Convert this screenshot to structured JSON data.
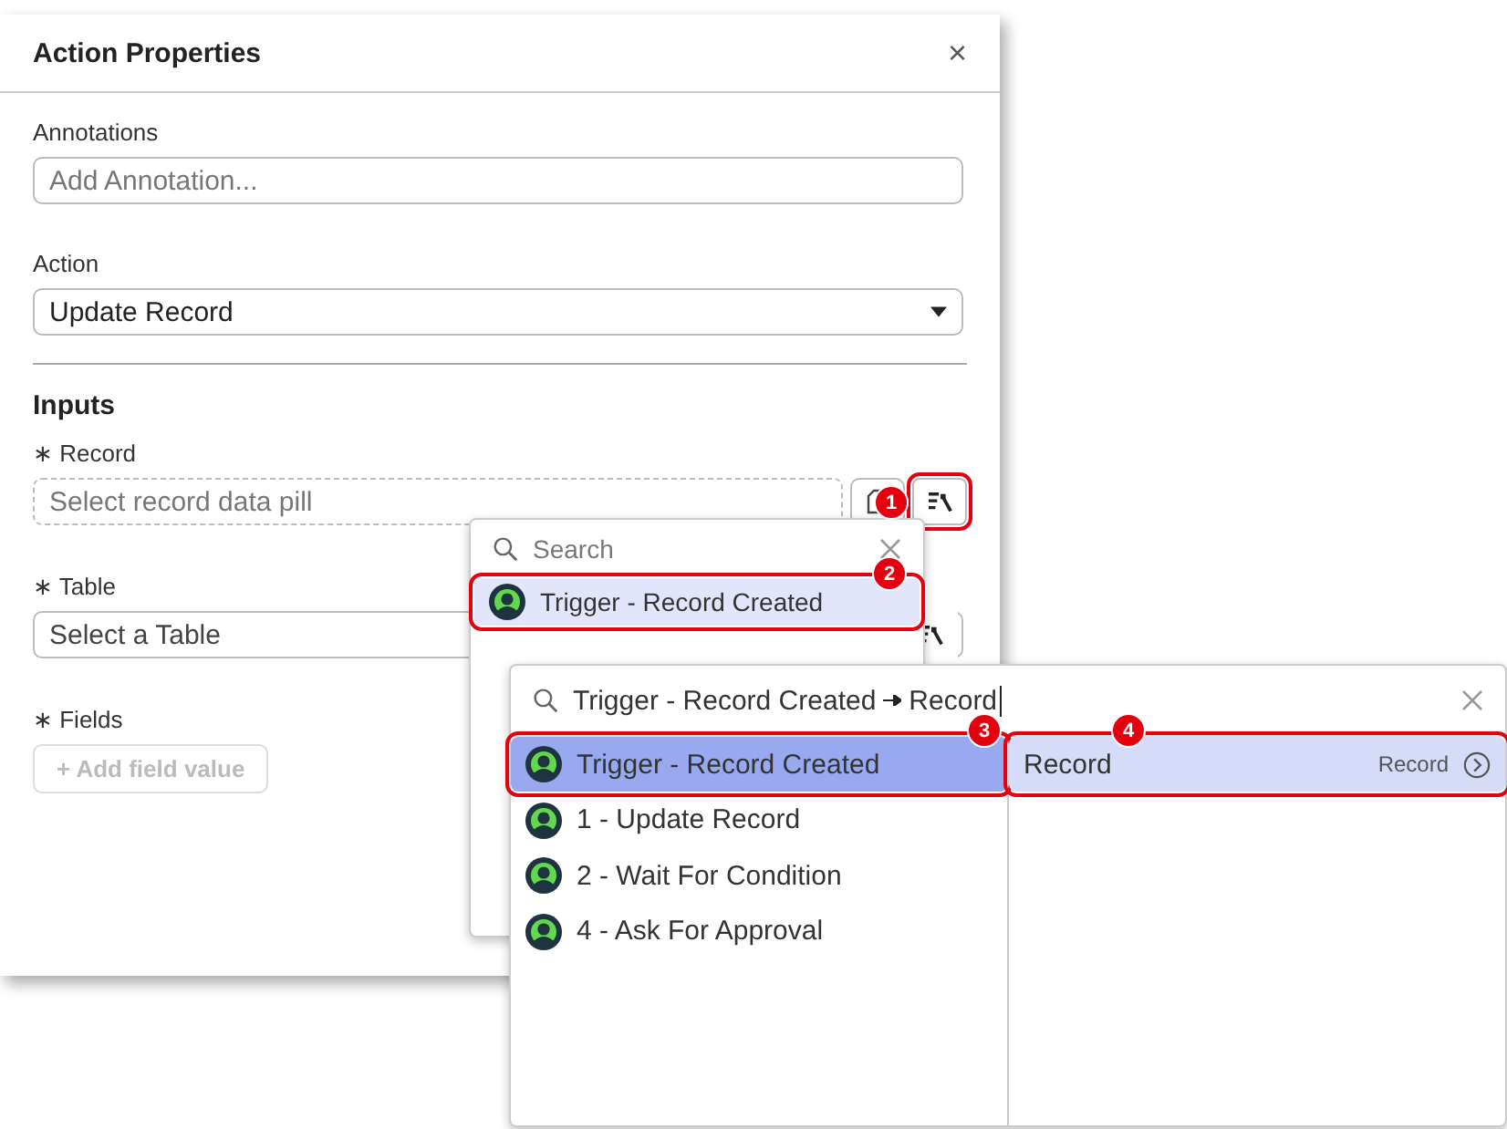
{
  "panel": {
    "title": "Action Properties",
    "close": "×"
  },
  "annotations": {
    "label": "Annotations",
    "placeholder": "Add Annotation..."
  },
  "action": {
    "label": "Action",
    "value": "Update Record"
  },
  "inputs": {
    "heading": "Inputs",
    "fields": [
      {
        "kind": "pill",
        "label": "∗ Record",
        "placeholder": "Select record data pill",
        "callout": "1"
      },
      {
        "kind": "table",
        "label": "∗ Table",
        "placeholder": "Select a Table"
      },
      {
        "kind": "add",
        "label": "∗ Fields",
        "button": "+ Add field value",
        "disabled": true
      }
    ]
  },
  "picker": {
    "placeholder": "Search",
    "items": [
      {
        "label": "Trigger - Record Created",
        "selected": true,
        "callout": "2"
      }
    ]
  },
  "explorer": {
    "query": [
      "Trigger - Record Created",
      "Record"
    ],
    "steps": [
      {
        "label": "Trigger - Record Created",
        "selected": true,
        "callout": "3"
      },
      {
        "label": "1 - Update Record",
        "selected": false
      },
      {
        "label": "2 - Wait For Condition",
        "selected": false
      },
      {
        "label": "4 - Ask For Approval",
        "selected": false
      }
    ],
    "fields": [
      {
        "label": "Record",
        "type": "Record",
        "selected": true,
        "callout": "4"
      }
    ]
  }
}
